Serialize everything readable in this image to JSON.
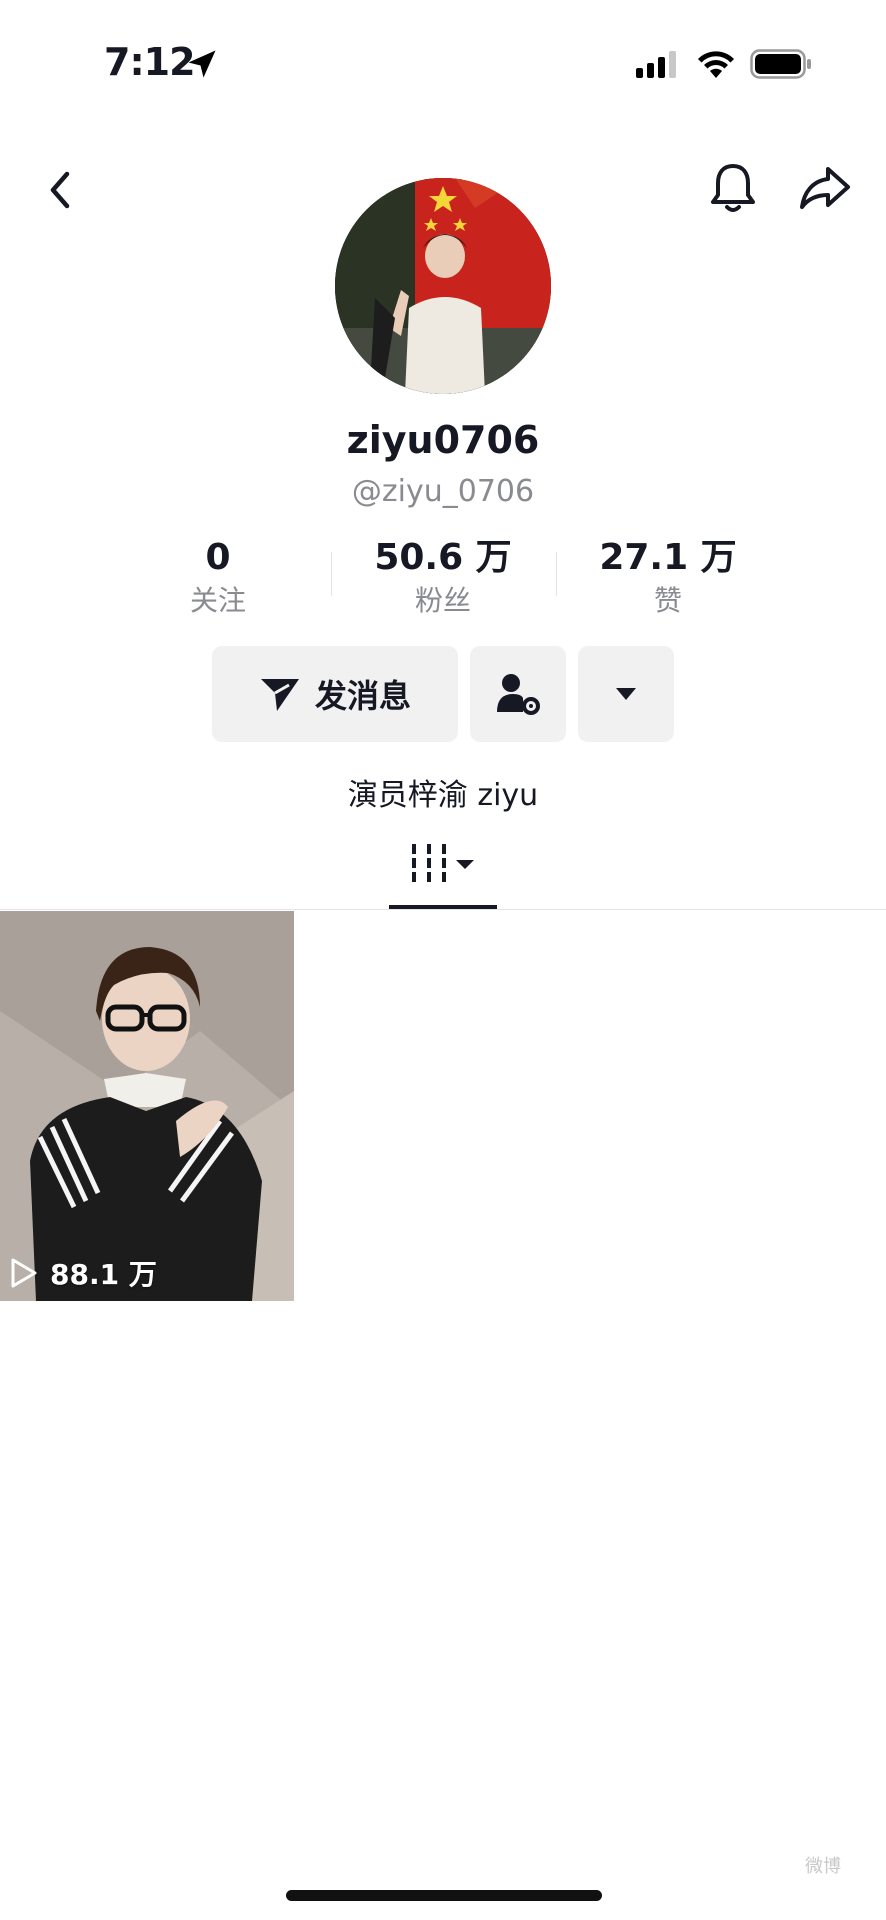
{
  "status_bar": {
    "time": "7:12",
    "location_icon": "location-arrow-icon",
    "signal_icon": "cellular-signal-icon",
    "wifi_icon": "wifi-icon",
    "battery_icon": "battery-icon"
  },
  "nav": {
    "back_icon": "chevron-left-icon",
    "bell_icon": "bell-icon",
    "share_icon": "share-arrow-icon"
  },
  "profile": {
    "display_name": "ziyu0706",
    "handle": "@ziyu_0706",
    "bio": "演员梓渝 ziyu"
  },
  "stats": [
    {
      "value": "0",
      "label": "关注"
    },
    {
      "value": "50.6 万",
      "label": "粉丝"
    },
    {
      "value": "27.1 万",
      "label": "赞"
    }
  ],
  "actions": {
    "message_label": "发消息",
    "message_icon": "send-icon",
    "user_settings_icon": "user-settings-icon",
    "dropdown_icon": "caret-down-icon"
  },
  "tabs": {
    "videos_icon": "grid-filter-icon"
  },
  "videos": [
    {
      "views": "88.1 万",
      "play_icon": "play-outline-icon"
    }
  ],
  "watermark": "微博",
  "colors": {
    "text_primary": "#161823",
    "text_secondary": "#8a8b91",
    "button_bg": "#f1f1f2"
  }
}
